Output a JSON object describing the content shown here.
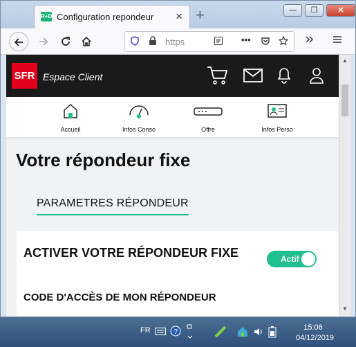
{
  "browser": {
    "tab_title": "Configuration repondeur",
    "favicon_text": "R+D",
    "url_text": "https",
    "close_tab": "×",
    "new_tab": "+",
    "window_controls": {
      "minimize": "—",
      "restore": "❐",
      "close": "✕"
    }
  },
  "site": {
    "logo": "SFR",
    "brand_subtitle": "Espace Client",
    "brand_color": "#e2001a",
    "accent_color": "#20c08e"
  },
  "menu": [
    {
      "label": "Accueil",
      "icon": "home-icon"
    },
    {
      "label": "Infos Conso",
      "icon": "gauge-icon"
    },
    {
      "label": "Offre",
      "icon": "modem-icon"
    },
    {
      "label": "Infos Perso",
      "icon": "id-card-icon"
    }
  ],
  "page": {
    "title": "Votre répondeur fixe",
    "tab_label": "PARAMETRES RÉPONDEUR",
    "card_title": "ACTIVER VOTRE RÉPONDEUR FIXE",
    "toggle_label": "Actif",
    "toggle_on": true,
    "section_title": "CODE D'ACCÈS DE MON RÉPONDEUR"
  },
  "taskbar": {
    "language": "FR",
    "time": "15:06",
    "date": "04/12/2019"
  }
}
